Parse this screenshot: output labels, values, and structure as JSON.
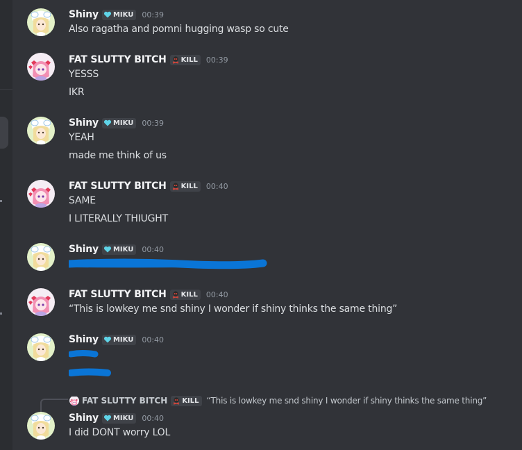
{
  "users": {
    "shiny": {
      "name": "Shiny",
      "tag": "MIKU",
      "tag_icon": "cyan-heart-icon",
      "tag_color": "#5fd4e8"
    },
    "other": {
      "name": "FAT SLUTTY BITCH",
      "tag": "KILL",
      "tag_icon": "skull-icon",
      "tag_color": "#c0392b"
    }
  },
  "messages": [
    {
      "author": "Shiny",
      "tag": "MIKU",
      "time": "00:39",
      "lines": [
        "Also ragatha and pomni hugging wasp so cute"
      ]
    },
    {
      "author": "FAT SLUTTY BITCH",
      "tag": "KILL",
      "time": "00:39",
      "lines": [
        "YESSS",
        "IKR"
      ]
    },
    {
      "author": "Shiny",
      "tag": "MIKU",
      "time": "00:39",
      "lines": [
        "YEAH",
        "made me think of us"
      ]
    },
    {
      "author": "FAT SLUTTY BITCH",
      "tag": "KILL",
      "time": "00:40",
      "lines": [
        "SAME",
        "I LITERALLY THIUGHT"
      ]
    },
    {
      "author": "Shiny",
      "tag": "MIKU",
      "time": "00:40",
      "lines": [],
      "redacted_lines": 1
    },
    {
      "author": "FAT SLUTTY BITCH",
      "tag": "KILL",
      "time": "00:40",
      "lines": [
        "“This is lowkey me snd shiny I wonder if shiny thinks the same thing”"
      ]
    },
    {
      "author": "Shiny",
      "tag": "MIKU",
      "time": "00:40",
      "lines": [],
      "redacted_lines": 2
    },
    {
      "author": "Shiny",
      "tag": "MIKU",
      "time": "00:40",
      "reply_to": {
        "author": "FAT SLUTTY BITCH",
        "tag": "KILL",
        "text": "“This is lowkey me snd shiny I wonder if shiny thinks the same thing”"
      },
      "lines": [
        "I did DONT worry LOL"
      ]
    }
  ],
  "colors": {
    "background": "#313338",
    "sidebar": "#2b2d31",
    "redaction": "#0a75d6"
  }
}
